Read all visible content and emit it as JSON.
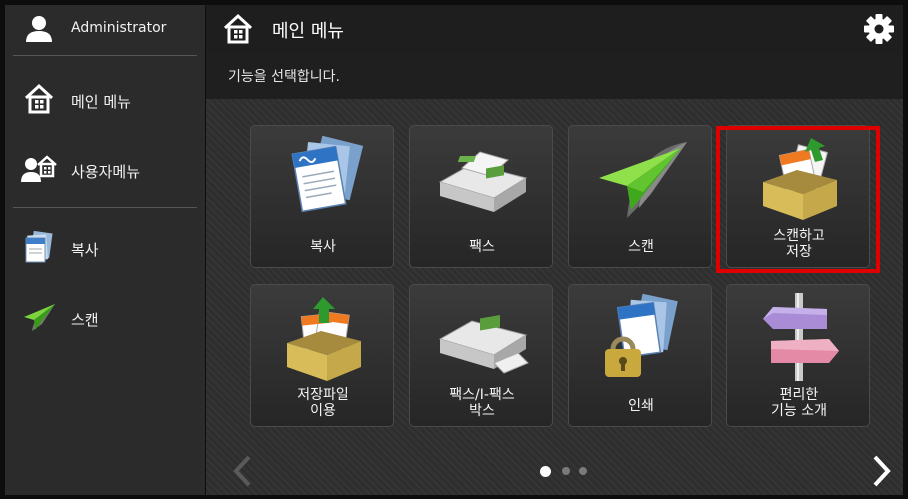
{
  "sidebar": {
    "user_label": "Administrator",
    "items": [
      {
        "label": "메인 메뉴",
        "icon": "home-icon"
      },
      {
        "label": "사용자메뉴",
        "icon": "users-icon"
      },
      {
        "label": "복사",
        "icon": "copy-icon"
      },
      {
        "label": "스캔",
        "icon": "scan-icon"
      }
    ]
  },
  "header": {
    "title": "메인 메뉴",
    "subtitle": "기능을 선택합니다."
  },
  "tiles": [
    {
      "label1": "복사",
      "label2": "",
      "icon": "copy-documents-icon"
    },
    {
      "label1": "팩스",
      "label2": "",
      "icon": "fax-machine-icon"
    },
    {
      "label1": "스캔",
      "label2": "",
      "icon": "paper-plane-icon"
    },
    {
      "label1": "스캔하고",
      "label2": "저장",
      "icon": "scan-to-box-icon",
      "selected": true
    },
    {
      "label1": "저장파일",
      "label2": "이용",
      "icon": "stored-files-box-icon"
    },
    {
      "label1": "팩스/I-팩스",
      "label2": "박스",
      "icon": "fax-box-icon"
    },
    {
      "label1": "인쇄",
      "label2": "",
      "icon": "secure-print-icon"
    },
    {
      "label1": "편리한",
      "label2": "기능 소개",
      "icon": "signpost-icon"
    }
  ],
  "pager": {
    "pages": 3,
    "current": 1
  },
  "colors": {
    "highlight": "#e00000",
    "background": "#2e2e2e"
  }
}
